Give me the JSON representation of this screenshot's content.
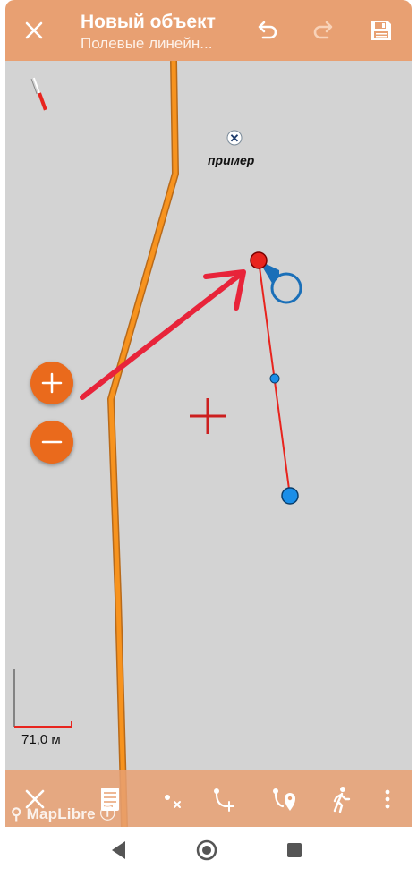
{
  "header": {
    "title": "Новый объект",
    "subtitle": "Полевые линейн...",
    "icons": {
      "close": "close-icon",
      "undo": "undo-icon",
      "redo": "redo-icon",
      "save": "save-icon"
    }
  },
  "map": {
    "poi_label": "пример",
    "scale_label": "71,0 м",
    "attribution": "MapLibre"
  },
  "toolbar_bottom": {
    "icons": [
      "close-icon",
      "notes-icon",
      "delete-node-icon",
      "add-node-icon",
      "route-point-icon",
      "walk-icon",
      "more-vert-icon"
    ]
  },
  "colors": {
    "header_bg": "#e8a072",
    "map_bg": "#d3d3d3",
    "accent_orange": "#ea6a1c",
    "route_line": "#f7931e",
    "track_red": "#e8241e",
    "node_blue": "#1a8ee8"
  }
}
